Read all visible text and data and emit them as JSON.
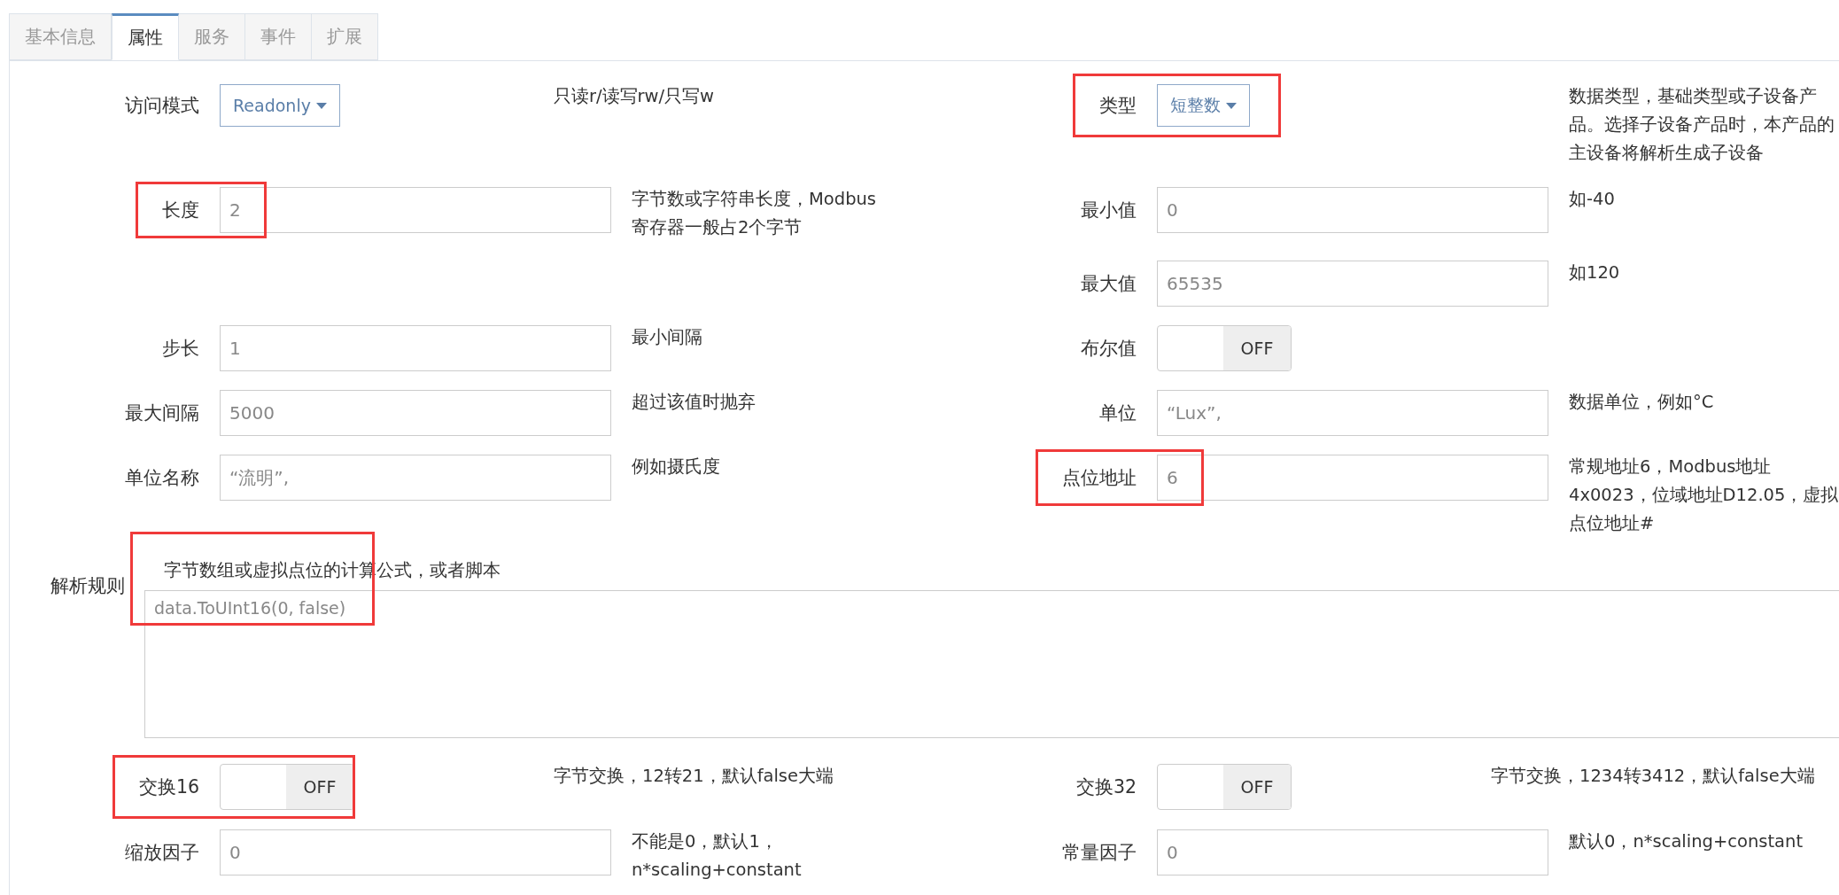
{
  "tabs": [
    {
      "label": "基本信息",
      "selected": false
    },
    {
      "label": "属性",
      "selected": true
    },
    {
      "label": "服务",
      "selected": false
    },
    {
      "label": "事件",
      "selected": false
    },
    {
      "label": "扩展",
      "selected": false
    }
  ],
  "rows": [
    {
      "left": {
        "label": "访问模式",
        "kind": "select",
        "value": "Readonly",
        "help": "只读r/读写rw/只写w",
        "highlighted": false
      },
      "right": {
        "label": "类型",
        "kind": "select",
        "value": "短整数",
        "help": "数据类型，基础类型或子设备产品。选择子设备产品时，本产品的主设备将解析生成子设备",
        "highlighted": true
      }
    },
    {
      "left": {
        "label": "长度",
        "kind": "input",
        "value": "2",
        "help": "字节数或字符串长度，Modbus寄存器一般占2个字节",
        "highlighted": true
      },
      "right": {
        "label": "最小值",
        "kind": "input",
        "value": "0",
        "help": "如-40",
        "highlighted": false
      }
    },
    {
      "right": {
        "label": "最大值",
        "kind": "input",
        "value": "65535",
        "help": "如120",
        "highlighted": false
      }
    },
    {
      "left": {
        "label": "步长",
        "kind": "input",
        "value": "1",
        "help": "最小间隔",
        "highlighted": false
      },
      "right": {
        "label": "布尔值",
        "kind": "toggle",
        "on": false,
        "state_label": "OFF",
        "highlighted": false
      }
    },
    {
      "left": {
        "label": "最大间隔",
        "kind": "input",
        "value": "5000",
        "help": "超过该值时抛弃",
        "highlighted": false
      },
      "right": {
        "label": "单位",
        "kind": "input",
        "value": "“Lux”,",
        "help": "数据单位，例如°C",
        "highlighted": false
      }
    },
    {
      "left": {
        "label": "单位名称",
        "kind": "input",
        "value": "“流明”,",
        "help": "例如摄氏度",
        "highlighted": false
      },
      "right": {
        "label": "点位地址",
        "kind": "input",
        "value": "6",
        "help": "常规地址6，Modbus地址4x0023，位域地址D12.05，虚拟点位地址#",
        "highlighted": true
      }
    }
  ],
  "parse_rule": {
    "label": "解析规则",
    "help": "字节数组或虚拟点位的计算公式，或者脚本",
    "value": "data.ToUInt16(0, false)",
    "highlighted": true
  },
  "bottom_rows": [
    {
      "left": {
        "label": "交换16",
        "kind": "toggle",
        "on": false,
        "state_label": "OFF",
        "help": "字节交换，12转21，默认false大端",
        "highlighted": true
      },
      "right": {
        "label": "交换32",
        "kind": "toggle",
        "on": false,
        "state_label": "OFF",
        "help": "字节交换，1234转3412，默认false大端",
        "highlighted": false
      }
    },
    {
      "left": {
        "label": "缩放因子",
        "kind": "input",
        "value": "0",
        "help": "不能是0，默认1，n*scaling+constant",
        "highlighted": false
      },
      "right": {
        "label": "常量因子",
        "kind": "input",
        "value": "0",
        "help": "默认0，n*scaling+constant",
        "highlighted": false
      }
    }
  ]
}
